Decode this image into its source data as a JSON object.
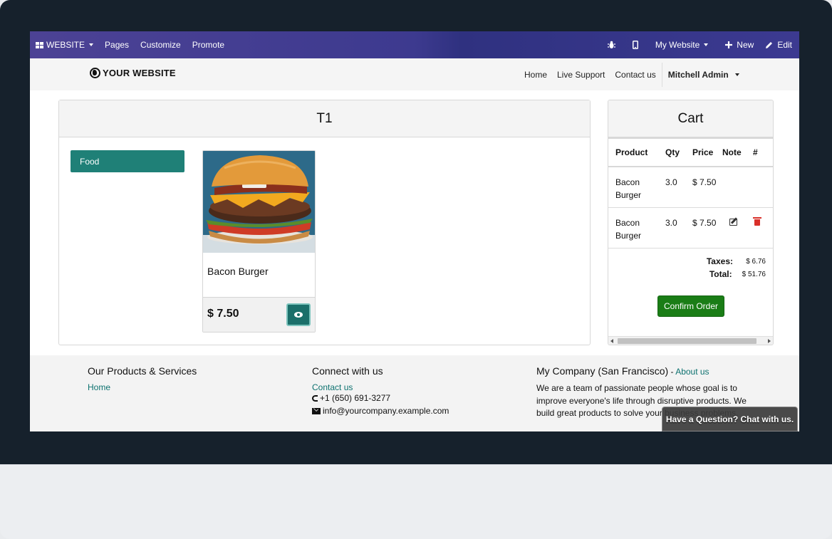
{
  "admin_bar": {
    "app_menu": "WEBSITE",
    "menu_items": [
      "Pages",
      "Customize",
      "Promote"
    ],
    "website_selector": "My Website",
    "new_label": "New",
    "edit_label": "Edit",
    "icons": [
      "bug-icon",
      "mobile-icon",
      "plus-icon",
      "pencil-icon"
    ]
  },
  "site_header": {
    "logo_text": "YOUR WEBSITE",
    "nav": [
      "Home",
      "Live Support",
      "Contact us"
    ],
    "user": "Mitchell Admin"
  },
  "table_panel": {
    "title": "T1",
    "category": "Food",
    "product": {
      "name": "Bacon Burger",
      "price": "$ 7.50"
    }
  },
  "cart": {
    "title": "Cart",
    "columns": [
      "Product",
      "Qty",
      "Price",
      "Note",
      "#"
    ],
    "rows": [
      {
        "product": "Bacon Burger",
        "qty": "3.0",
        "price": "$ 7.50",
        "has_actions": false
      },
      {
        "product": "Bacon Burger",
        "qty": "3.0",
        "price": "$ 7.50",
        "has_actions": true
      }
    ],
    "taxes_label": "Taxes:",
    "taxes_value": "$ 6.76",
    "total_label": "Total:",
    "total_value": "$ 51.76",
    "confirm_label": "Confirm Order"
  },
  "footer": {
    "col1": {
      "heading": "Our Products & Services",
      "links": [
        "Home"
      ]
    },
    "col2": {
      "heading": "Connect with us",
      "link": "Contact us",
      "phone": "+1 (650) 691-3277",
      "email": "info@yourcompany.example.com"
    },
    "col3": {
      "heading": "My Company (San Francisco)",
      "about_sep": " - ",
      "about_link": "About us",
      "text": "We are a team of passionate people whose goal is to improve everyone's life through disruptive products. We build great products to solve your business problems."
    },
    "chat_label": "Have a Question? Chat with us."
  },
  "colors": {
    "admin_bar": "#3d3a8f",
    "accent_teal": "#1f8077",
    "confirm_green": "#1a7d16",
    "delete_red": "#d9302a"
  }
}
